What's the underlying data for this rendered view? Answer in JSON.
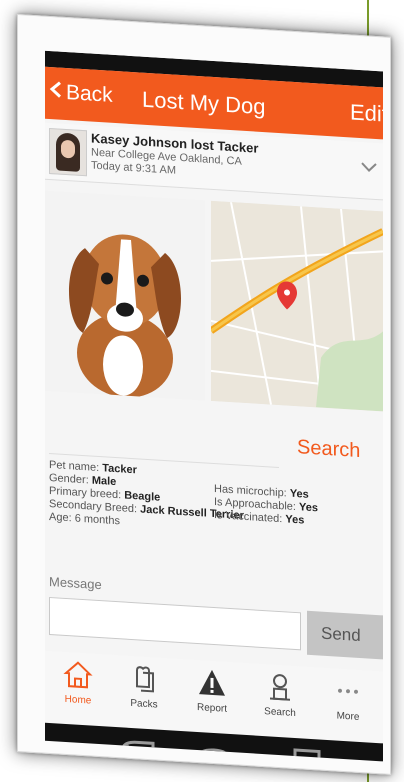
{
  "header": {
    "back_label": "Back",
    "title": "Lost My Dog",
    "edit_label": "Edit"
  },
  "post": {
    "poster_line": "Kasey Johnson lost Tacker",
    "location": "Near College Ave Oakland, CA",
    "time": "Today at 9:31 AM"
  },
  "search_label": "Search",
  "pet_details": {
    "name_label": "Pet name:",
    "name_value": "Tacker",
    "gender_label": "Gender:",
    "gender_value": "Male",
    "primary_label": "Primary breed:",
    "primary_value": "Beagle",
    "secondary_label": "Secondary Breed:",
    "secondary_value": "Jack Russell Terrier",
    "age_label": "Age:",
    "age_value": "6 months",
    "microchip_label": "Has microchip:",
    "microchip_value": "Yes",
    "approachable_label": "Is Approachable:",
    "approachable_value": "Yes",
    "vaccinated_label": "Is Vaccinated:",
    "vaccinated_value": "Yes"
  },
  "message": {
    "label": "Message",
    "send_label": "Send"
  },
  "tabs": [
    {
      "label": "Home"
    },
    {
      "label": "Packs"
    },
    {
      "label": "Report"
    },
    {
      "label": "Search"
    },
    {
      "label": "More"
    }
  ],
  "colors": {
    "accent": "#f25a1e",
    "tab_active": "#f25a1e",
    "decor_line": "#7a9c2a"
  }
}
